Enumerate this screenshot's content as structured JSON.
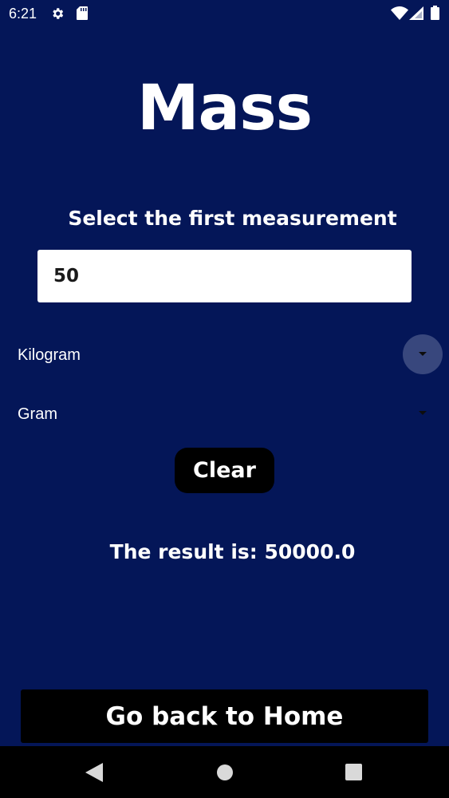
{
  "status_bar": {
    "time": "6:21",
    "icons": [
      "gear-icon",
      "sd-card-icon",
      "wifi-icon",
      "signal-icon",
      "battery-icon"
    ]
  },
  "page": {
    "title": "Mass",
    "subtitle": "Select the first measurement"
  },
  "input": {
    "value": "50"
  },
  "spinners": {
    "from_unit": "Kilogram",
    "to_unit": "Gram"
  },
  "buttons": {
    "clear_label": "Clear",
    "home_label": "Go back to Home"
  },
  "result": {
    "text": "The result is: 50000.0"
  },
  "nav_bar": {
    "icons": [
      "back-icon",
      "home-icon",
      "recents-icon"
    ]
  },
  "colors": {
    "background": "#041658",
    "button": "#000000",
    "text": "#ffffff"
  }
}
